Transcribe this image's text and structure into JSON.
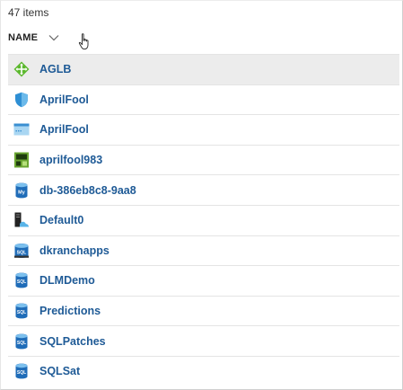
{
  "item_count_text": "47 items",
  "column_header": {
    "label": "NAME",
    "sort_icon": "chevron-down-icon"
  },
  "colors": {
    "link": "#1e5a96",
    "selected_row": "#ececec",
    "divider": "#e4e4e4"
  },
  "items": [
    {
      "name": "AGLB",
      "icon": "load-balancer-icon",
      "selected": true
    },
    {
      "name": "AprilFool",
      "icon": "shield-icon",
      "selected": false
    },
    {
      "name": "AprilFool",
      "icon": "app-service-plan-icon",
      "selected": false
    },
    {
      "name": "aprilfool983",
      "icon": "storage-account-icon",
      "selected": false
    },
    {
      "name": "db-386eb8c8-9aa8",
      "icon": "mysql-database-icon",
      "selected": false
    },
    {
      "name": "Default0",
      "icon": "server-cloud-icon",
      "selected": false
    },
    {
      "name": "dkranchapps",
      "icon": "sql-server-icon",
      "selected": false
    },
    {
      "name": "DLMDemo",
      "icon": "sql-database-icon",
      "selected": false
    },
    {
      "name": "Predictions",
      "icon": "sql-database-icon",
      "selected": false
    },
    {
      "name": "SQLPatches",
      "icon": "sql-database-icon",
      "selected": false
    },
    {
      "name": "SQLSat",
      "icon": "sql-database-icon",
      "selected": false
    }
  ]
}
